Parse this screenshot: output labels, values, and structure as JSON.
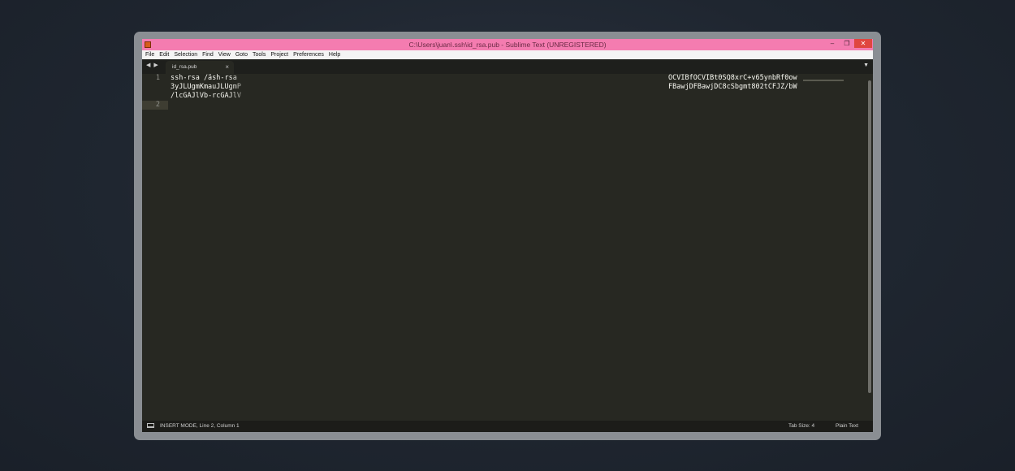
{
  "window": {
    "title": "C:\\Users\\juan\\.ssh\\id_rsa.pub - Sublime Text (UNREGISTERED)",
    "controls": {
      "minimize": "–",
      "maximize": "❐",
      "close": "✕"
    }
  },
  "menu": [
    "File",
    "Edit",
    "Selection",
    "Find",
    "View",
    "Goto",
    "Tools",
    "Project",
    "Preferences",
    "Help"
  ],
  "tabs": {
    "nav": "◀ ▶",
    "active": {
      "label": "id_rsa.pub",
      "close": "×"
    },
    "dropdown": "▼"
  },
  "editor": {
    "line_numbers": [
      "1",
      "2"
    ],
    "left_lines": [
      "ssh-rsa /äsh-rsa",
      "3yJLUgmKmauJLUgmP",
      "/lcGAJlVb-rcGAJlV"
    ],
    "right_lines": [
      "OCVIBfOCVIBt0SQ8xrC+v65ynbRf0ow",
      "FBawjDFBawjDC8cSbgmt802tCFJZ/bW"
    ]
  },
  "status": {
    "mode": "INSERT MODE, Line 2, Column 1",
    "tab_size": "Tab Size: 4",
    "syntax": "Plain Text"
  },
  "colors": {
    "titlebar": "#f47cb0",
    "editor_bg": "#272822",
    "close_button": "#e0463f"
  }
}
